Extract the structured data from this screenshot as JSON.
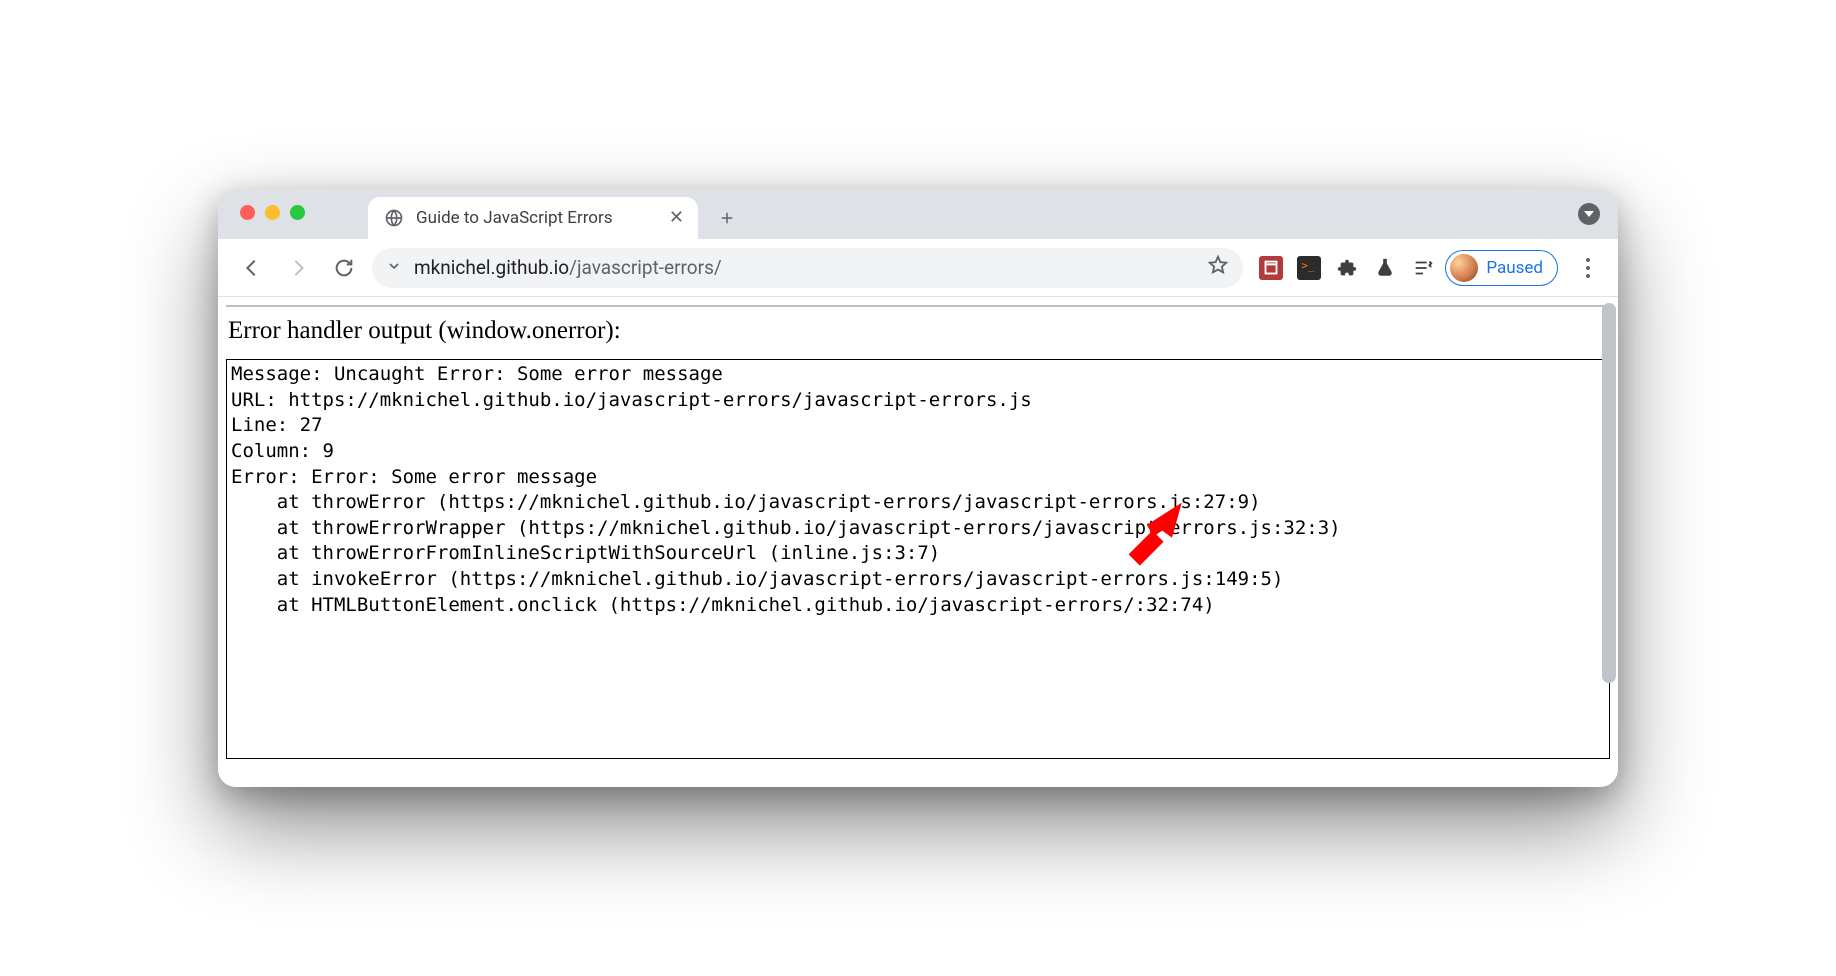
{
  "tab": {
    "title": "Guide to JavaScript Errors"
  },
  "url": {
    "host": "mknichel.github.io",
    "path": "/javascript-errors/"
  },
  "profile": {
    "status": "Paused"
  },
  "page": {
    "heading": "Error handler output (window.onerror):",
    "output": "Message: Uncaught Error: Some error message\nURL: https://mknichel.github.io/javascript-errors/javascript-errors.js\nLine: 27\nColumn: 9\nError: Error: Some error message\n    at throwError (https://mknichel.github.io/javascript-errors/javascript-errors.js:27:9)\n    at throwErrorWrapper (https://mknichel.github.io/javascript-errors/javascript-errors.js:32:3)\n    at throwErrorFromInlineScriptWithSourceUrl (inline.js:3:7)\n    at invokeError (https://mknichel.github.io/javascript-errors/javascript-errors.js:149:5)\n    at HTMLButtonElement.onclick (https://mknichel.github.io/javascript-errors/:32:74)"
  }
}
